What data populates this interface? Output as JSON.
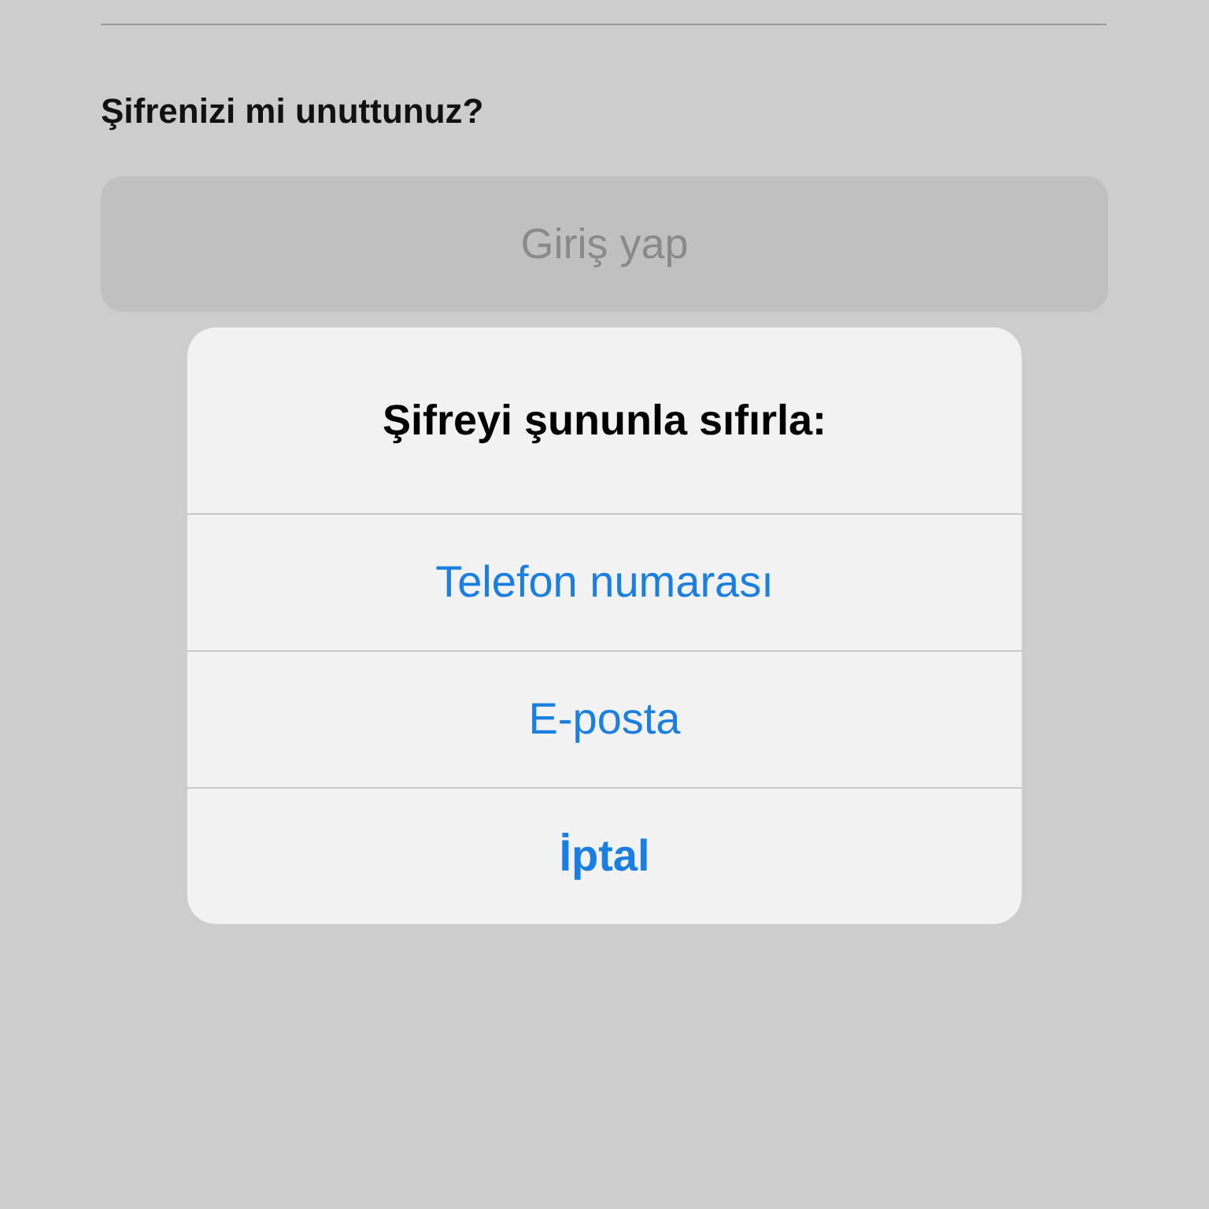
{
  "login": {
    "forgot_link": "Şifrenizi mi unuttunuz?",
    "login_button": {
      "label": "Giriş yap",
      "disabled": true
    }
  },
  "alert": {
    "title": "Şifreyi şununla sıfırla:",
    "actions": [
      {
        "label": "Telefon numarası",
        "kind": "default"
      },
      {
        "label": "E-posta",
        "kind": "default"
      },
      {
        "label": "İptal",
        "kind": "cancel"
      }
    ]
  }
}
